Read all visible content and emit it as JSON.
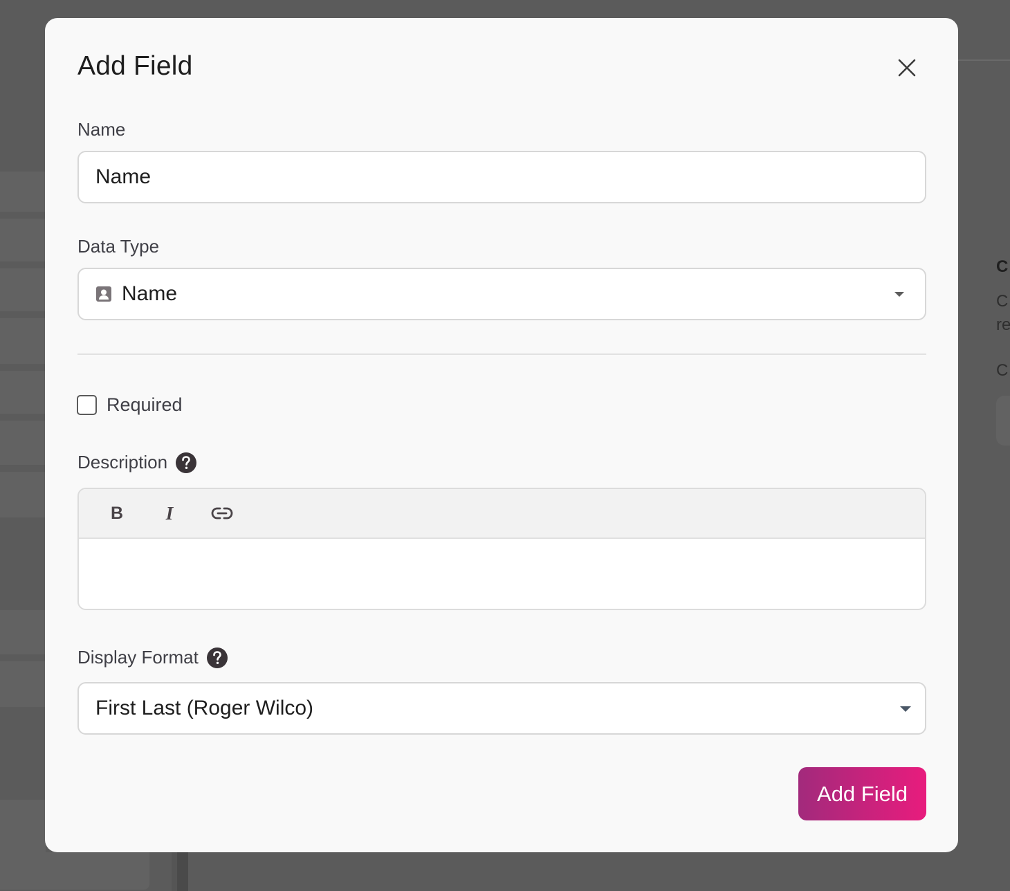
{
  "background": {
    "right_texts": [
      "C",
      "C",
      "re",
      "C"
    ]
  },
  "modal": {
    "title": "Add Field",
    "close_icon": "close-icon",
    "name_field": {
      "label": "Name",
      "value": "Name",
      "placeholder": ""
    },
    "data_type_field": {
      "label": "Data Type",
      "icon": "person-card-icon",
      "selected": "Name"
    },
    "required_checkbox": {
      "label": "Required",
      "checked": false
    },
    "description_field": {
      "label": "Description",
      "help_icon": "question-circle-icon",
      "toolbar": {
        "bold": "B",
        "italic": "I",
        "link_icon": "link-icon"
      },
      "value": ""
    },
    "display_format_field": {
      "label": "Display Format",
      "help_icon": "question-circle-icon",
      "selected": "First Last (Roger Wilco)"
    },
    "submit_label": "Add Field"
  },
  "colors": {
    "overlay": "#5b5b5b",
    "modal_bg": "#f9f9f9",
    "button_gradient_start": "#a22a7c",
    "button_gradient_end": "#e81c7d"
  }
}
